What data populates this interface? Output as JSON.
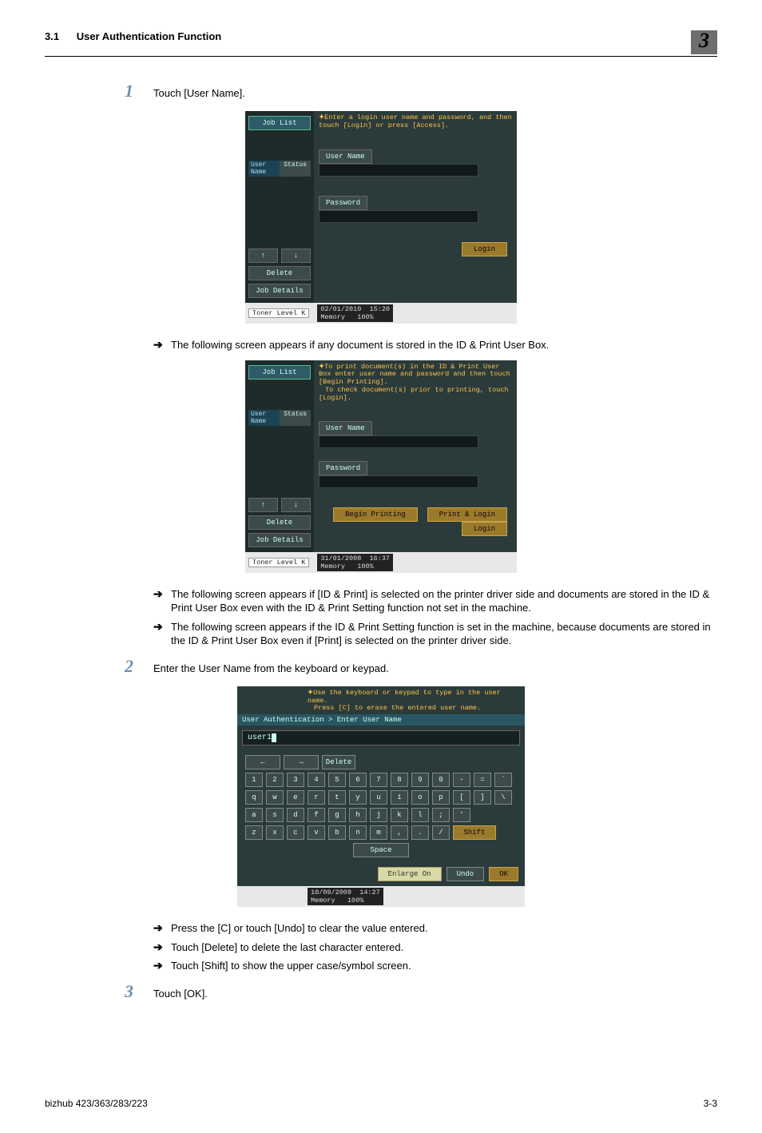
{
  "header": {
    "section": "3.1",
    "title": "User Authentication Function",
    "chapter": "3"
  },
  "steps": {
    "s1": {
      "num": "1",
      "text": "Touch [User Name]."
    },
    "s2": {
      "num": "2",
      "text": "Enter the User Name from the keyboard or keypad."
    },
    "s3": {
      "num": "3",
      "text": "Touch [OK]."
    }
  },
  "arrows": {
    "a1": "The following screen appears if any document is stored in the ID & Print User Box.",
    "a2": "The following screen appears if [ID & Print] is selected on the printer driver side and documents are stored in the ID & Print User Box even with the ID & Print Setting function not set in the machine.",
    "a3": "The following screen appears if the ID & Print Setting function is set in the machine, because documents are stored in the ID & Print User Box even if [Print] is selected on the printer driver side.",
    "a4": "Press the [C] or touch [Undo] to clear the value entered.",
    "a5": "Touch [Delete] to delete the last character entered.",
    "a6": "Touch [Shift] to show the upper case/symbol screen."
  },
  "dev1": {
    "job_list": "Job List",
    "user_name_hdr": "User Name",
    "status": "Status",
    "info": "Enter a login user name and password, and then touch [Login] or press [Access].",
    "user_name_btn": "User Name",
    "password_btn": "Password",
    "delete": "Delete",
    "job_details": "Job Details",
    "login": "Login",
    "toner": "Toner Level  K",
    "date": "02/01/2010",
    "time": "15:20",
    "mem_label": "Memory",
    "mem_val": "100%"
  },
  "dev2": {
    "job_list": "Job List",
    "user_name_hdr": "User Name",
    "status": "Status",
    "info1": "To print document(s) in the ID & Print User Box enter user name and password and then touch [Begin Printing].",
    "info2": "To check document(s) prior to printing, touch [Login].",
    "user_name_btn": "User Name",
    "password_btn": "Password",
    "delete": "Delete",
    "job_details": "Job Details",
    "begin_printing": "Begin Printing",
    "print_login": "Print & Login",
    "login": "Login",
    "toner": "Toner Level  K",
    "date": "31/01/2008",
    "time": "16:37",
    "mem_label": "Memory",
    "mem_val": "100%"
  },
  "kbd": {
    "info1": "Use the keyboard or keypad to type in the user name.",
    "info2": "Press [C] to erase the entered user name.",
    "breadcrumb": "User Authentication > Enter User Name",
    "input_value": "user1",
    "left": "←",
    "right": "→",
    "delete": "Delete",
    "row1": [
      "1",
      "2",
      "3",
      "4",
      "5",
      "6",
      "7",
      "8",
      "9",
      "0",
      "-",
      "=",
      "`"
    ],
    "row2": [
      "q",
      "w",
      "e",
      "r",
      "t",
      "y",
      "u",
      "i",
      "o",
      "p",
      "[",
      "]",
      "\\"
    ],
    "row3": [
      "a",
      "s",
      "d",
      "f",
      "g",
      "h",
      "j",
      "k",
      "l",
      ";",
      "'"
    ],
    "row4": [
      "z",
      "x",
      "c",
      "v",
      "b",
      "n",
      "m",
      ",",
      ".",
      "/"
    ],
    "shift": "Shift",
    "space": "Space",
    "enlarge": "Enlarge On",
    "undo": "Undo",
    "ok": "OK",
    "date": "10/09/2009",
    "time": "14:27",
    "mem_label": "Memory",
    "mem_val": "100%"
  },
  "footer": {
    "left": "bizhub 423/363/283/223",
    "right": "3-3"
  }
}
